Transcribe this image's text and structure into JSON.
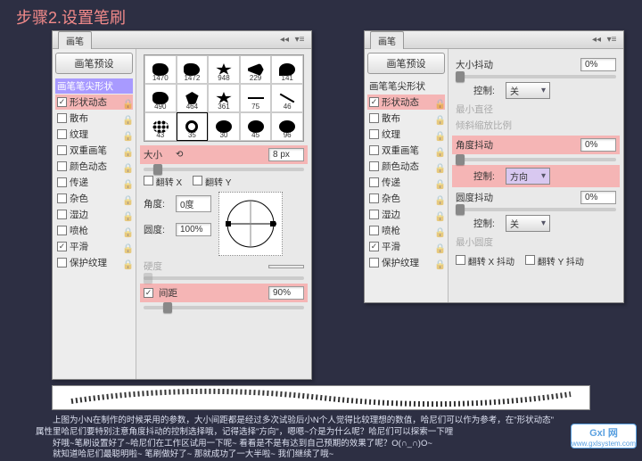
{
  "title": "步骤2.设置笔刷",
  "tab_label": "画笔",
  "preset_btn": "画笔预设",
  "sidebar": [
    {
      "label": "画笔笔尖形状",
      "cb": null
    },
    {
      "label": "形状动态",
      "cb": true
    },
    {
      "label": "散布",
      "cb": false
    },
    {
      "label": "纹理",
      "cb": false
    },
    {
      "label": "双重画笔",
      "cb": false
    },
    {
      "label": "颜色动态",
      "cb": false
    },
    {
      "label": "传递",
      "cb": false
    },
    {
      "label": "杂色",
      "cb": false
    },
    {
      "label": "湿边",
      "cb": false
    },
    {
      "label": "喷枪",
      "cb": false
    },
    {
      "label": "平滑",
      "cb": true
    },
    {
      "label": "保护纹理",
      "cb": false
    }
  ],
  "brushes": {
    "row1": [
      "1470",
      "1472",
      "948",
      "229",
      "141"
    ],
    "row2": [
      "490",
      "464",
      "361",
      "75",
      "46"
    ],
    "row3": [
      "43",
      "35",
      "30",
      "45",
      "96"
    ]
  },
  "left": {
    "size_label": "大小",
    "size_value": "8 px",
    "flipx": "翻转 X",
    "flipy": "翻转 Y",
    "angle_label": "角度:",
    "angle_value": "0度",
    "round_label": "圆度:",
    "round_value": "100%",
    "hardness_label": "硬度",
    "spacing_label": "间距",
    "spacing_value": "90%"
  },
  "right": {
    "size_jitter": "大小抖动",
    "size_jitter_val": "0%",
    "control": "控制:",
    "off": "关",
    "min_diam": "最小直径",
    "tilt_scale": "倾斜缩放比例",
    "angle_jitter": "角度抖动",
    "angle_jitter_val": "0%",
    "direction": "方向",
    "round_jitter": "圆度抖动",
    "round_jitter_val": "0%",
    "min_round": "最小圆度",
    "flipx_j": "翻转 X 抖动",
    "flipy_j": "翻转 Y 抖动"
  },
  "footer": {
    "l1": "上图为小N在制作的时候采用的参数，大小间距都是经过多次试验后小N个人觉得比较理想的数值，哈尼们可以作为参考，在\"形状动态\"",
    "l2": "属性里哈尼们要特别注意角度抖动的控制选择哦，记得选择\"方向\"，嗯嗯~介是为什么呢？哈尼们可以探索一下哩",
    "l3": "好哦~笔刷设置好了~哈尼们在工作区试用一下呢~ 看看是不是有达到自己预期的效果了呢？O(∩_∩)O~",
    "l4": "就知道哈尼们最聪明啦~ 笔刷做好了~ 那就成功了一大半啦~  我们继续了哦~"
  },
  "watermark": {
    "brand": "Gxl 网",
    "url": "www.gxlsystem.com"
  }
}
